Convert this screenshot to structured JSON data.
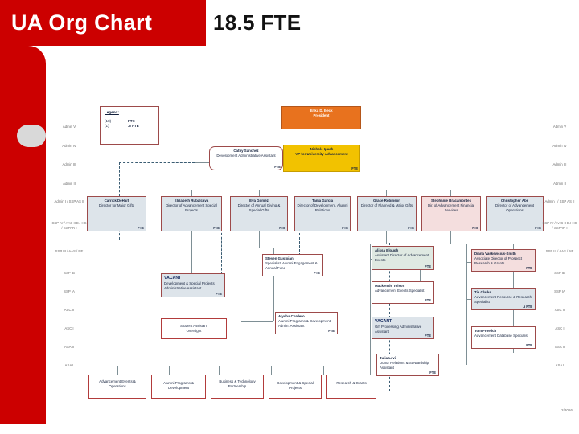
{
  "slide": {
    "title": "UA Org Chart",
    "subtitle": "18.5 FTE",
    "accent_color": "#cc0000",
    "date_stamp": "2/2016"
  },
  "legend": {
    "heading": "Legend:",
    "rows": [
      {
        "count": "(18)",
        "unit": "FTE"
      },
      {
        "count": "(1)",
        "unit": ".5 FTE"
      }
    ]
  },
  "chart_data": {
    "type": "diagram",
    "title": "UA Org Chart",
    "total_fte": "18.5 FTE",
    "nodes": [
      {
        "id": "president",
        "name": "Erika D. Beck",
        "role": "President",
        "fte": "",
        "style": "president"
      },
      {
        "id": "vp",
        "name": "Nichole Ipach",
        "role": "VP for University Advancement",
        "fte": "FTE",
        "style": "vp"
      },
      {
        "id": "devadmin",
        "name": "Cathy Sanchez",
        "role": "Development Administrative Assistant",
        "fte": "FTE",
        "style": "rounded"
      },
      {
        "id": "dehart",
        "name": "Carrick DeHart",
        "role": "Director for Major Gifts",
        "fte": "FTE",
        "style": "standard"
      },
      {
        "id": "rubalcava",
        "name": "Elizabeth Rubalcava",
        "role": "Director of Advancement Special Projects",
        "fte": "FTE",
        "style": "standard"
      },
      {
        "id": "gomez",
        "name": "Eva Gomez",
        "role": "Director of Annual Giving & Special Gifts",
        "fte": "FTE",
        "style": "standard"
      },
      {
        "id": "garcia",
        "name": "Tania Garcia",
        "role": "Director of Development, Alumni Relations",
        "fte": "FTE",
        "style": "standard"
      },
      {
        "id": "robinson",
        "name": "Grace Robinson",
        "role": "Director of Planned & Major Gifts",
        "fte": "FTE",
        "style": "standard"
      },
      {
        "id": "bracamontes",
        "name": "Stephanie Bracamontes",
        "role": "Dir. of Advancement Financial Services",
        "fte": "FTE",
        "style": "pink"
      },
      {
        "id": "abe",
        "name": "Christopher Abe",
        "role": "Director of Advancement Operations",
        "fte": "FTE",
        "style": "standard"
      },
      {
        "id": "vacant_dsp",
        "name": "VACANT",
        "role": "Development & Special Projects Administrative Assistant",
        "fte": "FTE",
        "style": "vacant"
      },
      {
        "id": "gustoian",
        "name": "Steven Gustoian",
        "role": "Specialist, Alumni Engagement & Annual Fund",
        "fte": "FTE",
        "style": "white"
      },
      {
        "id": "blough",
        "name": "Alissa Blough",
        "role": "Assistant Director of Advancement Events",
        "fte": "FTE",
        "style": "mint"
      },
      {
        "id": "tolson",
        "name": "Mackenzie Tolson",
        "role": "Advancement Events Specialist",
        "fte": "FTE",
        "style": "white"
      },
      {
        "id": "vaskevicius",
        "name": "Diana Vaskevicius-Smith",
        "role": "Associate Director of Prospect Research & Grants",
        "fte": "FTE",
        "style": "pink"
      },
      {
        "id": "clarke",
        "name": "Tia Clarke",
        "role": "Advancement Resource & Research Specialist",
        "fte": ".5 FTE",
        "style": "standard"
      },
      {
        "id": "froelich",
        "name": "Tom Froelich",
        "role": "Advancement Database Specialist",
        "fte": "FTE",
        "style": "white"
      },
      {
        "id": "cordero",
        "name": "Alysha Cordero",
        "role": "Alumni Programs & Development Admin. Assistant",
        "fte": "FTE",
        "style": "white"
      },
      {
        "id": "vacant_gift",
        "name": "VACANT",
        "role": "Gift Processing Administrative Assistant",
        "fte": "FTE",
        "style": "vacant"
      },
      {
        "id": "levi",
        "name": "Julia Levi",
        "role": "Donor Relations & Stewardship Assistant",
        "fte": "FTE",
        "style": "white"
      },
      {
        "id": "stu_assist",
        "name": "Student Assistant",
        "role": "Oversight",
        "fte": "",
        "style": "redbox"
      }
    ],
    "function_row": [
      {
        "id": "fn_events",
        "label": "Advancement Events & Operations"
      },
      {
        "id": "fn_alumni",
        "label": "Alumni Programs & Development"
      },
      {
        "id": "fn_biztech",
        "label": "Business & Technology Partnership"
      },
      {
        "id": "fn_devsp",
        "label": "Development & Special Projects"
      },
      {
        "id": "fn_research",
        "label": "Research & Grants"
      }
    ],
    "classification_rulers": [
      "Admin V",
      "Admin IV",
      "Admin III",
      "Admin II",
      "Admin I / SSP AS II",
      "SSP IV / AAS II E.I HS / SSPAR I",
      "SSP III / AAS / NE",
      "SSP IB",
      "SSP IA",
      "ASC II",
      "ASC I",
      "ASA II",
      "ASA I"
    ]
  }
}
